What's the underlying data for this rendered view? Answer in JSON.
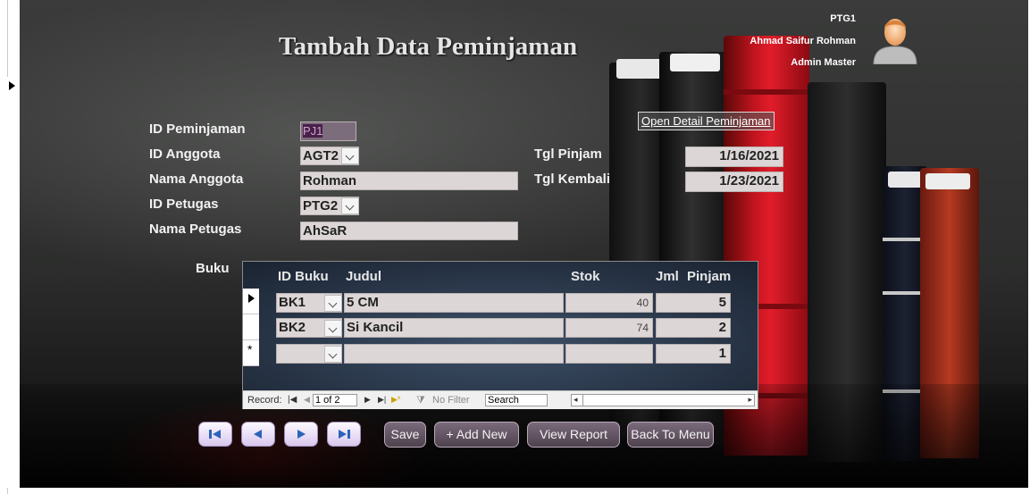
{
  "title": "Tambah Data Peminjaman",
  "user": {
    "id": "PTG1",
    "name": "Ahmad Saifur Rohman",
    "role": "Admin Master"
  },
  "labels": {
    "id_peminjaman": "ID Peminjaman",
    "id_anggota": "ID Anggota",
    "nama_anggota": "Nama Anggota",
    "id_petugas": "ID Petugas",
    "nama_petugas": "Nama Petugas",
    "tgl_pinjam": "Tgl Pinjam",
    "tgl_kembali": "Tgl Kembali",
    "buku": "Buku"
  },
  "values": {
    "id_peminjaman": "PJ1",
    "id_anggota": "AGT2",
    "nama_anggota": "Rohman",
    "id_petugas": "PTG2",
    "nama_petugas": "AhSaR",
    "tgl_pinjam": "1/16/2021",
    "tgl_kembali": "1/23/2021"
  },
  "link": "Open Detail Peminjaman",
  "subform": {
    "headers": {
      "id_buku": "ID Buku",
      "judul": "Judul",
      "stok": "Stok",
      "jml": "Jml",
      "pinjam": "Pinjam"
    },
    "rows": [
      {
        "id_buku": "BK1",
        "judul": "5 CM",
        "stok": "40",
        "jml": "5"
      },
      {
        "id_buku": "BK2",
        "judul": "Si Kancil",
        "stok": "74",
        "jml": "2"
      },
      {
        "id_buku": "",
        "judul": "",
        "stok": "",
        "jml": "1"
      }
    ],
    "nav": {
      "record_label": "Record:",
      "position": "1 of 2",
      "filter": "No Filter",
      "search": "Search"
    }
  },
  "buttons": {
    "save": "Save",
    "add_new": "+ Add New",
    "view_report": "View Report",
    "back_to_menu": "Back To Menu"
  }
}
